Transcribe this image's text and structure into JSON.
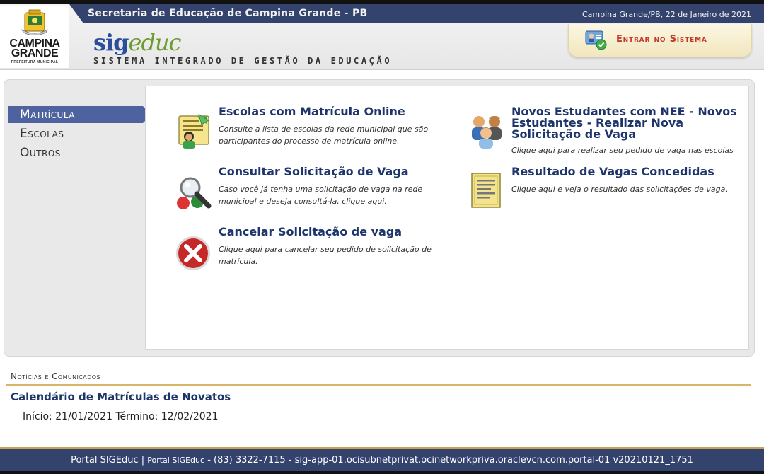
{
  "header": {
    "logo_line1": "CAMPINA",
    "logo_line2": "GRANDE",
    "logo_line3": "PREFEITURA MUNICIPAL",
    "secretaria": "Secretaria de Educação de Campina Grande - PB",
    "date": "Campina Grande/PB, 22 de Janeiro de 2021",
    "sig_part": "sig",
    "educ_part": "educ",
    "subtitle": "SISTEMA INTEGRADO DE GESTÃO DA EDUCAÇÃO",
    "login_label": "Entrar no Sistema"
  },
  "menu": {
    "items": [
      {
        "label": "Matrícula",
        "active": true
      },
      {
        "label": "Escolas",
        "active": false
      },
      {
        "label": "Outros",
        "active": false
      }
    ]
  },
  "items": [
    {
      "title": "Escolas com Matrícula Online",
      "desc": "Consulte a lista de escolas da rede municipal que são participantes do processo de matrícula online.",
      "icon": "school-list-icon"
    },
    {
      "title": "Consultar Solicitação de Vaga",
      "desc": "Caso você já tenha uma solicitação de vaga na rede municipal e deseja consultá-la, clique aqui.",
      "icon": "magnifier-icon"
    },
    {
      "title": "Cancelar Solicitação de vaga",
      "desc": "Clique aqui para cancelar seu pedido de solicitação de matrícula.",
      "icon": "cancel-icon"
    },
    {
      "title": "Novos Estudantes com NEE - Novos Estudantes - Realizar Nova Solicitação de Vaga",
      "desc": "Clique aqui para realizar seu pedido de vaga nas escolas",
      "icon": "students-group-icon"
    },
    {
      "title": "Resultado de Vagas Concedidas",
      "desc": "Clique aqui e veja o resultado das solicitações de vaga.",
      "icon": "document-list-icon"
    }
  ],
  "news": {
    "label": "Notícias e Comunicados",
    "title": "Calendário de Matrículas de Novatos",
    "dates": "Início: 21/01/2021 Término: 12/02/2021"
  },
  "footer": {
    "part1": "Portal SIGEduc |",
    "part2": "Portal SIGEduc",
    "part3": "- (83) 3322-7115 - sig-app-01.ocisubnetprivat.ocinetworkpriva.oraclevcn.com.portal-01 v20210121_1751"
  },
  "colors": {
    "primary_blue": "#34436e",
    "menu_active": "#4f62a0",
    "link_blue": "#1e356b",
    "login_red": "#c2382a",
    "accent_gold": "#c9a44c"
  }
}
